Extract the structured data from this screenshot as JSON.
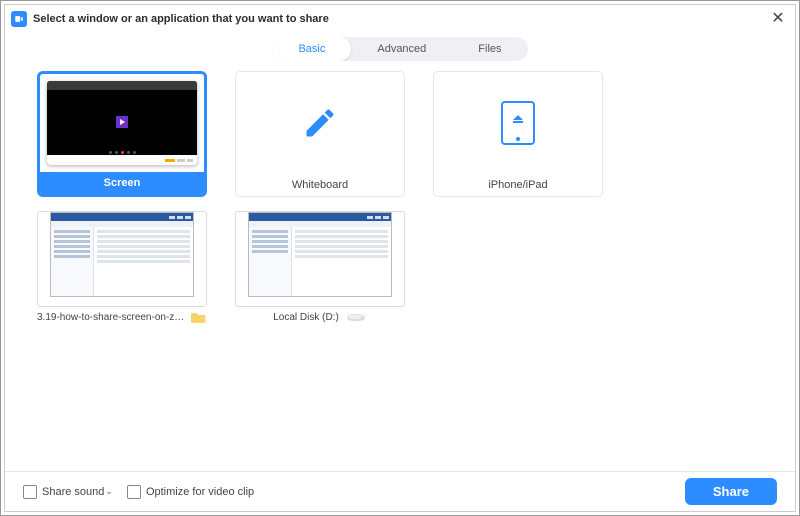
{
  "window": {
    "title": "Select a window or an application that you want to share"
  },
  "tabs": {
    "basic": "Basic",
    "advanced": "Advanced",
    "files": "Files",
    "active": "basic"
  },
  "options": {
    "screen": {
      "label": "Screen",
      "selected": true
    },
    "whiteboard": {
      "label": "Whiteboard"
    },
    "iphone_ipad": {
      "label": "iPhone/iPad"
    }
  },
  "windows": [
    {
      "label": "3.19-how-to-share-screen-on-zo...",
      "icon": "folder"
    },
    {
      "label": "Local Disk (D:)",
      "icon": "disk"
    }
  ],
  "footer": {
    "share_sound": "Share sound",
    "optimize": "Optimize for video clip",
    "share_button": "Share"
  },
  "icons": {
    "zoom": "zoom-logo",
    "close": "✕",
    "pencil": "pencil",
    "airplay": "airplay-tablet",
    "folder": "folder",
    "disk": "drive",
    "chevron": "⌄"
  },
  "colors": {
    "accent": "#2D8CFF"
  }
}
